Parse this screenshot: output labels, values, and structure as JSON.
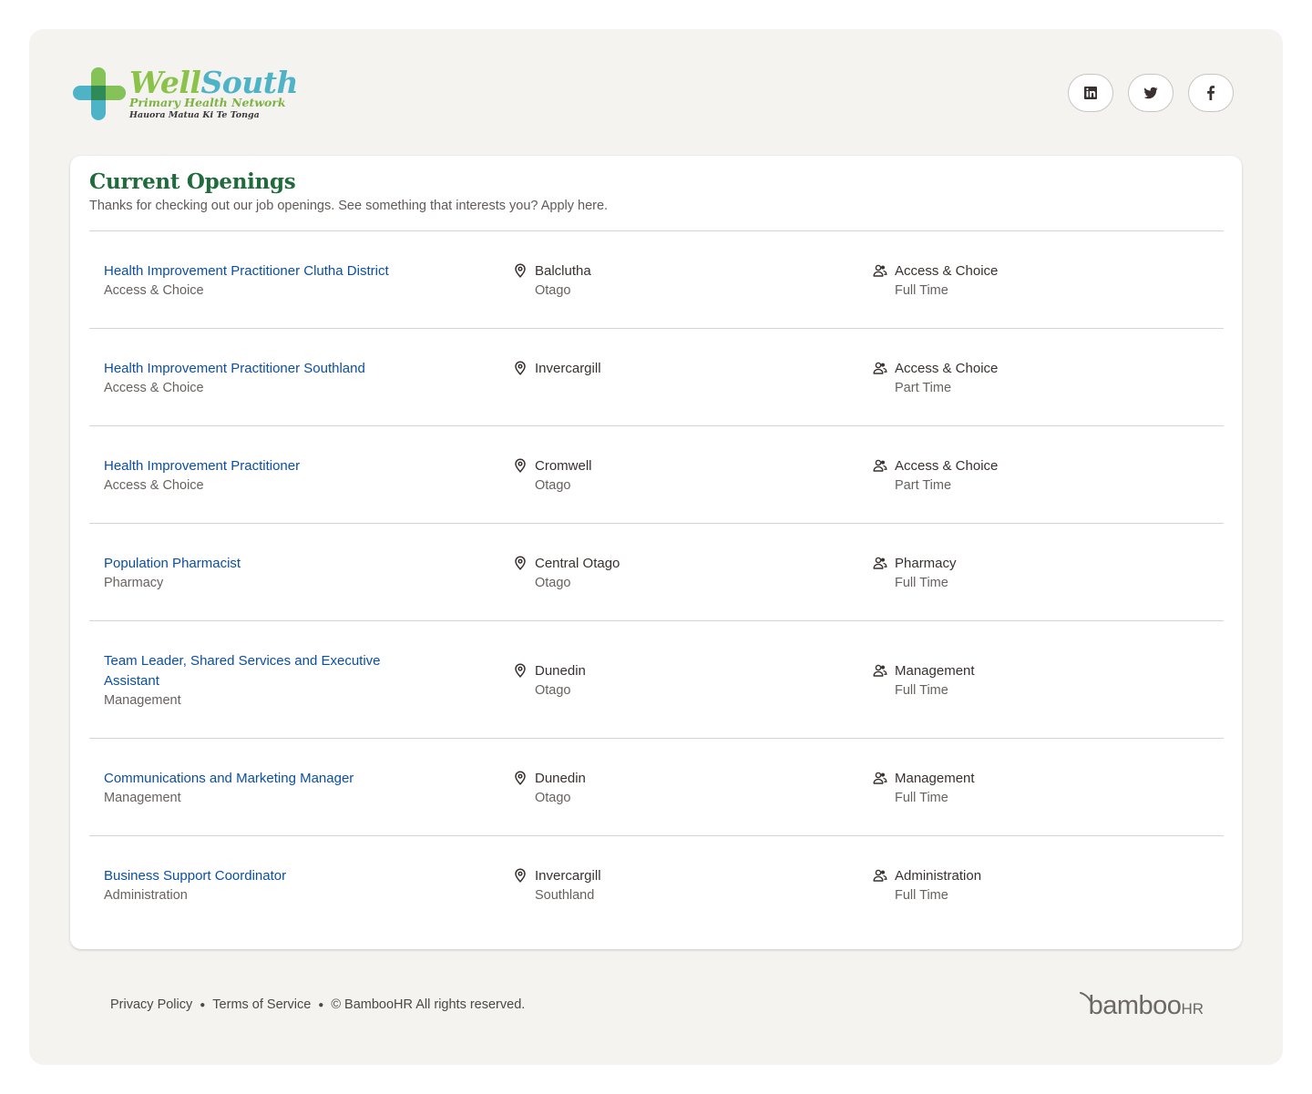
{
  "brand": {
    "name_part1": "Well",
    "name_part2": "South",
    "subtitle": "Primary Health Network",
    "maori": "Hauora Matua Ki Te Tonga",
    "colors": {
      "green": "#8bc34a",
      "teal": "#4fb3c8",
      "dark_green": "#1f6b3b"
    }
  },
  "socials": [
    {
      "name": "linkedin-icon"
    },
    {
      "name": "twitter-icon"
    },
    {
      "name": "facebook-icon"
    }
  ],
  "openings": {
    "title": "Current Openings",
    "subtitle": "Thanks for checking out our job openings. See something that interests you? Apply here.",
    "jobs": [
      {
        "title": "Health Improvement Practitioner Clutha District",
        "department": "Access & Choice",
        "city": "Balclutha",
        "region": "Otago",
        "team": "Access & Choice",
        "type": "Full Time"
      },
      {
        "title": "Health Improvement Practitioner Southland",
        "department": "Access & Choice",
        "city": "Invercargill",
        "region": "",
        "team": "Access & Choice",
        "type": "Part Time"
      },
      {
        "title": "Health Improvement Practitioner",
        "department": "Access & Choice",
        "city": "Cromwell",
        "region": "Otago",
        "team": "Access & Choice",
        "type": "Part Time"
      },
      {
        "title": "Population Pharmacist",
        "department": "Pharmacy",
        "city": "Central Otago",
        "region": "Otago",
        "team": "Pharmacy",
        "type": "Full Time"
      },
      {
        "title": "Team Leader, Shared Services and Executive Assistant",
        "department": "Management",
        "city": "Dunedin",
        "region": "Otago",
        "team": "Management",
        "type": "Full Time"
      },
      {
        "title": "Communications and Marketing Manager",
        "department": "Management",
        "city": "Dunedin",
        "region": "Otago",
        "team": "Management",
        "type": "Full Time"
      },
      {
        "title": "Business Support Coordinator",
        "department": "Administration",
        "city": "Invercargill",
        "region": "Southland",
        "team": "Administration",
        "type": "Full Time"
      }
    ]
  },
  "footer": {
    "privacy": "Privacy Policy",
    "terms": "Terms of Service",
    "copyright": "© BambooHR All rights reserved.",
    "bamboo_word": "bamboo",
    "bamboo_hr": "HR"
  }
}
